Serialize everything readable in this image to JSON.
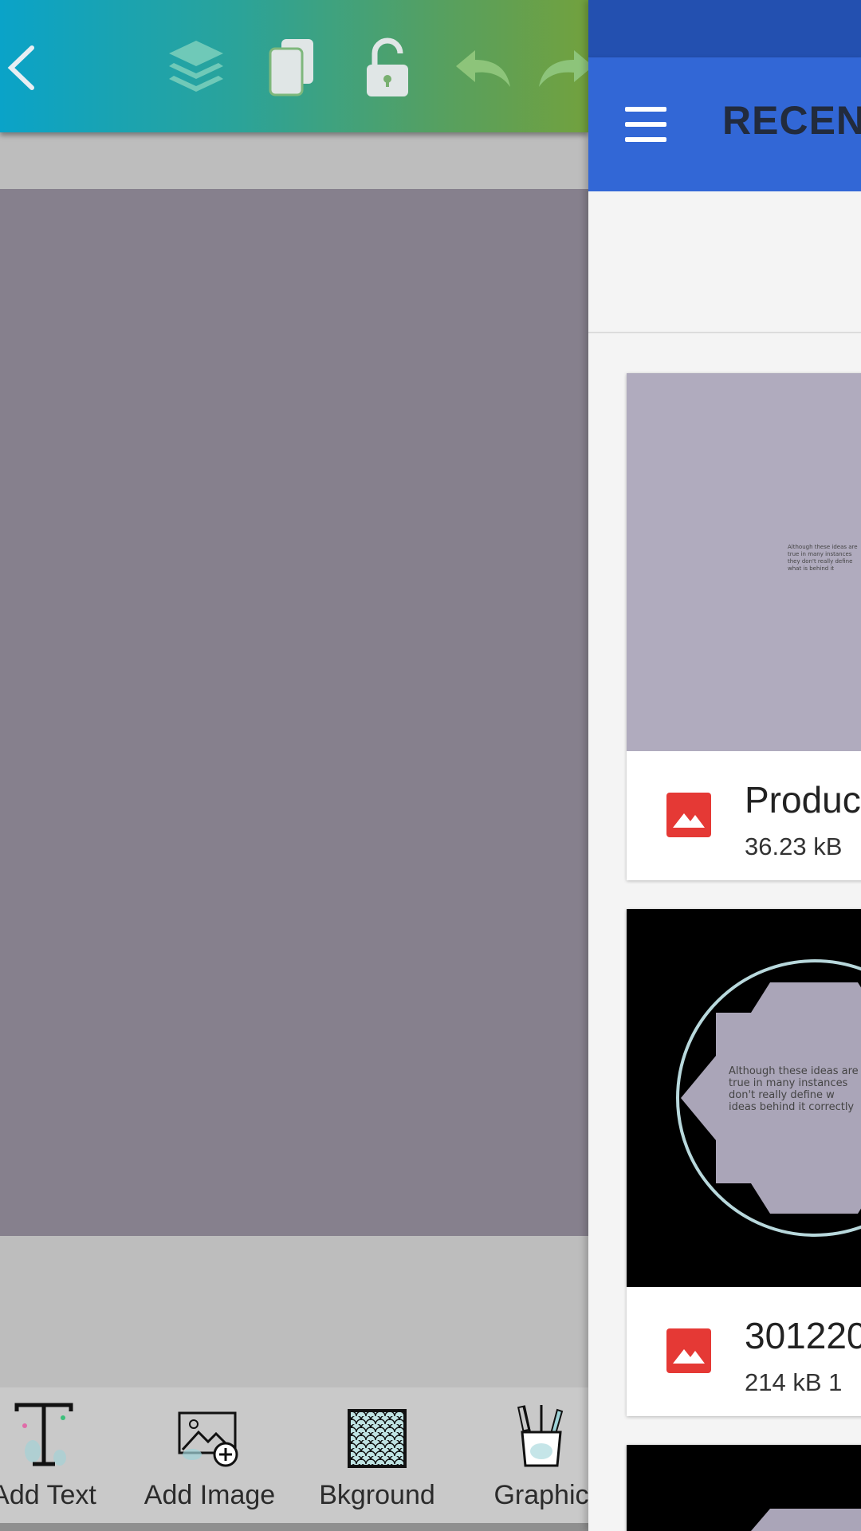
{
  "editor": {
    "toolbar": {
      "icons": [
        "back-icon",
        "layers-icon",
        "duplicate-icon",
        "unlock-icon",
        "undo-icon",
        "redo-icon"
      ]
    },
    "tools": [
      {
        "label": "Add Text",
        "icon": "add-text-icon"
      },
      {
        "label": "Add Image",
        "icon": "add-image-icon"
      },
      {
        "label": "Bkground",
        "icon": "background-pattern-icon"
      },
      {
        "label": "Graphic",
        "icon": "graphics-pencil-cup-icon"
      }
    ],
    "colors": {
      "toolbar_start": "#0aa3c8",
      "toolbar_end": "#72a13e",
      "canvas": "#86808d"
    }
  },
  "drawer": {
    "title": "RECENT",
    "colors": {
      "appbar": "#3267d6",
      "status": "#2350b0",
      "file_icon": "#e53935"
    },
    "files": [
      {
        "name": "Produc",
        "meta": "36.23 kB",
        "thumb_text": "Although these ideas are\ntrue in many instances\nthey don't really define\nwhat is behind it"
      },
      {
        "name": "301220",
        "meta": "214 kB 1",
        "thumb_text": "Although these ideas are\ntrue in many instances\ndon't really define w\nideas behind it correctly"
      }
    ]
  }
}
